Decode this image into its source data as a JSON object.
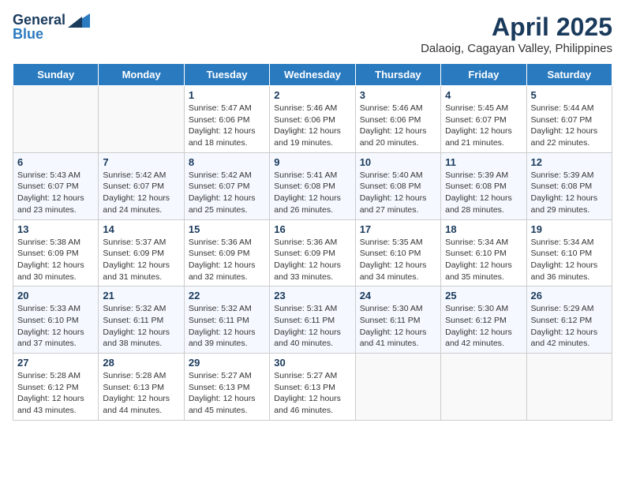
{
  "header": {
    "logo_general": "General",
    "logo_blue": "Blue",
    "month": "April 2025",
    "location": "Dalaoig, Cagayan Valley, Philippines"
  },
  "days_of_week": [
    "Sunday",
    "Monday",
    "Tuesday",
    "Wednesday",
    "Thursday",
    "Friday",
    "Saturday"
  ],
  "weeks": [
    [
      {
        "day": "",
        "info": ""
      },
      {
        "day": "",
        "info": ""
      },
      {
        "day": "1",
        "info": "Sunrise: 5:47 AM\nSunset: 6:06 PM\nDaylight: 12 hours and 18 minutes."
      },
      {
        "day": "2",
        "info": "Sunrise: 5:46 AM\nSunset: 6:06 PM\nDaylight: 12 hours and 19 minutes."
      },
      {
        "day": "3",
        "info": "Sunrise: 5:46 AM\nSunset: 6:06 PM\nDaylight: 12 hours and 20 minutes."
      },
      {
        "day": "4",
        "info": "Sunrise: 5:45 AM\nSunset: 6:07 PM\nDaylight: 12 hours and 21 minutes."
      },
      {
        "day": "5",
        "info": "Sunrise: 5:44 AM\nSunset: 6:07 PM\nDaylight: 12 hours and 22 minutes."
      }
    ],
    [
      {
        "day": "6",
        "info": "Sunrise: 5:43 AM\nSunset: 6:07 PM\nDaylight: 12 hours and 23 minutes."
      },
      {
        "day": "7",
        "info": "Sunrise: 5:42 AM\nSunset: 6:07 PM\nDaylight: 12 hours and 24 minutes."
      },
      {
        "day": "8",
        "info": "Sunrise: 5:42 AM\nSunset: 6:07 PM\nDaylight: 12 hours and 25 minutes."
      },
      {
        "day": "9",
        "info": "Sunrise: 5:41 AM\nSunset: 6:08 PM\nDaylight: 12 hours and 26 minutes."
      },
      {
        "day": "10",
        "info": "Sunrise: 5:40 AM\nSunset: 6:08 PM\nDaylight: 12 hours and 27 minutes."
      },
      {
        "day": "11",
        "info": "Sunrise: 5:39 AM\nSunset: 6:08 PM\nDaylight: 12 hours and 28 minutes."
      },
      {
        "day": "12",
        "info": "Sunrise: 5:39 AM\nSunset: 6:08 PM\nDaylight: 12 hours and 29 minutes."
      }
    ],
    [
      {
        "day": "13",
        "info": "Sunrise: 5:38 AM\nSunset: 6:09 PM\nDaylight: 12 hours and 30 minutes."
      },
      {
        "day": "14",
        "info": "Sunrise: 5:37 AM\nSunset: 6:09 PM\nDaylight: 12 hours and 31 minutes."
      },
      {
        "day": "15",
        "info": "Sunrise: 5:36 AM\nSunset: 6:09 PM\nDaylight: 12 hours and 32 minutes."
      },
      {
        "day": "16",
        "info": "Sunrise: 5:36 AM\nSunset: 6:09 PM\nDaylight: 12 hours and 33 minutes."
      },
      {
        "day": "17",
        "info": "Sunrise: 5:35 AM\nSunset: 6:10 PM\nDaylight: 12 hours and 34 minutes."
      },
      {
        "day": "18",
        "info": "Sunrise: 5:34 AM\nSunset: 6:10 PM\nDaylight: 12 hours and 35 minutes."
      },
      {
        "day": "19",
        "info": "Sunrise: 5:34 AM\nSunset: 6:10 PM\nDaylight: 12 hours and 36 minutes."
      }
    ],
    [
      {
        "day": "20",
        "info": "Sunrise: 5:33 AM\nSunset: 6:10 PM\nDaylight: 12 hours and 37 minutes."
      },
      {
        "day": "21",
        "info": "Sunrise: 5:32 AM\nSunset: 6:11 PM\nDaylight: 12 hours and 38 minutes."
      },
      {
        "day": "22",
        "info": "Sunrise: 5:32 AM\nSunset: 6:11 PM\nDaylight: 12 hours and 39 minutes."
      },
      {
        "day": "23",
        "info": "Sunrise: 5:31 AM\nSunset: 6:11 PM\nDaylight: 12 hours and 40 minutes."
      },
      {
        "day": "24",
        "info": "Sunrise: 5:30 AM\nSunset: 6:11 PM\nDaylight: 12 hours and 41 minutes."
      },
      {
        "day": "25",
        "info": "Sunrise: 5:30 AM\nSunset: 6:12 PM\nDaylight: 12 hours and 42 minutes."
      },
      {
        "day": "26",
        "info": "Sunrise: 5:29 AM\nSunset: 6:12 PM\nDaylight: 12 hours and 42 minutes."
      }
    ],
    [
      {
        "day": "27",
        "info": "Sunrise: 5:28 AM\nSunset: 6:12 PM\nDaylight: 12 hours and 43 minutes."
      },
      {
        "day": "28",
        "info": "Sunrise: 5:28 AM\nSunset: 6:13 PM\nDaylight: 12 hours and 44 minutes."
      },
      {
        "day": "29",
        "info": "Sunrise: 5:27 AM\nSunset: 6:13 PM\nDaylight: 12 hours and 45 minutes."
      },
      {
        "day": "30",
        "info": "Sunrise: 5:27 AM\nSunset: 6:13 PM\nDaylight: 12 hours and 46 minutes."
      },
      {
        "day": "",
        "info": ""
      },
      {
        "day": "",
        "info": ""
      },
      {
        "day": "",
        "info": ""
      }
    ]
  ]
}
